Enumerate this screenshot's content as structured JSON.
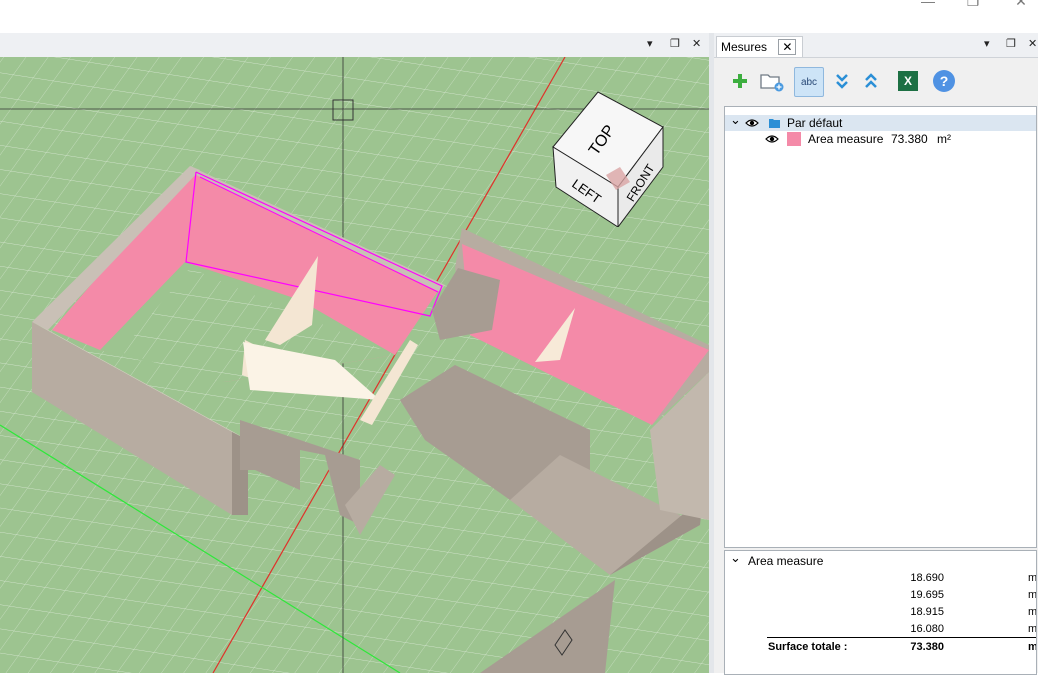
{
  "window": {
    "minimize_glyph": "—",
    "restore_glyph": "❐",
    "close_glyph": "✕"
  },
  "viewport_header": {
    "menu_glyph": "▾",
    "float_glyph": "❐",
    "close_glyph": "✕"
  },
  "viewcube": {
    "top": "TOP",
    "left": "LEFT",
    "front": "FRONT"
  },
  "measures_panel": {
    "tab_label": "Mesures",
    "tab_close": "✕",
    "menu_glyph": "▾",
    "float_glyph": "❐",
    "close_glyph": "✕",
    "toolbar": {
      "abc_label": "abc",
      "excel_label": "X",
      "help_label": "?"
    },
    "tree": {
      "group": {
        "label": "Par défaut",
        "expander": "⌄"
      },
      "item": {
        "label": "Area measure",
        "value": "73.380",
        "unit": "m²",
        "swatch_color": "#f48aa8"
      }
    },
    "properties": {
      "expander": "⌄",
      "title": "Area measure",
      "rows": [
        {
          "value": "18.690",
          "unit": "m"
        },
        {
          "value": "19.695",
          "unit": "m"
        },
        {
          "value": "18.915",
          "unit": "m"
        },
        {
          "value": "16.080",
          "unit": "m"
        }
      ],
      "total": {
        "label": "Surface totale :",
        "value": "73.380",
        "unit": "m"
      }
    }
  },
  "colors": {
    "grid_green": "#9dc490",
    "area_pink": "#f48aa8",
    "wall": "#b7aca1",
    "selection": "#ff00ff"
  }
}
